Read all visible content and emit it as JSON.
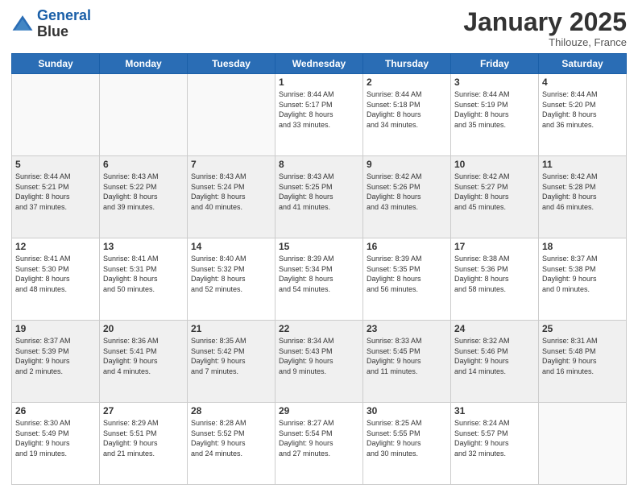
{
  "logo": {
    "line1": "General",
    "line2": "Blue"
  },
  "header": {
    "month": "January 2025",
    "location": "Thilouze, France"
  },
  "weekdays": [
    "Sunday",
    "Monday",
    "Tuesday",
    "Wednesday",
    "Thursday",
    "Friday",
    "Saturday"
  ],
  "weeks": [
    [
      {
        "day": "",
        "info": ""
      },
      {
        "day": "",
        "info": ""
      },
      {
        "day": "",
        "info": ""
      },
      {
        "day": "1",
        "info": "Sunrise: 8:44 AM\nSunset: 5:17 PM\nDaylight: 8 hours\nand 33 minutes."
      },
      {
        "day": "2",
        "info": "Sunrise: 8:44 AM\nSunset: 5:18 PM\nDaylight: 8 hours\nand 34 minutes."
      },
      {
        "day": "3",
        "info": "Sunrise: 8:44 AM\nSunset: 5:19 PM\nDaylight: 8 hours\nand 35 minutes."
      },
      {
        "day": "4",
        "info": "Sunrise: 8:44 AM\nSunset: 5:20 PM\nDaylight: 8 hours\nand 36 minutes."
      }
    ],
    [
      {
        "day": "5",
        "info": "Sunrise: 8:44 AM\nSunset: 5:21 PM\nDaylight: 8 hours\nand 37 minutes."
      },
      {
        "day": "6",
        "info": "Sunrise: 8:43 AM\nSunset: 5:22 PM\nDaylight: 8 hours\nand 39 minutes."
      },
      {
        "day": "7",
        "info": "Sunrise: 8:43 AM\nSunset: 5:24 PM\nDaylight: 8 hours\nand 40 minutes."
      },
      {
        "day": "8",
        "info": "Sunrise: 8:43 AM\nSunset: 5:25 PM\nDaylight: 8 hours\nand 41 minutes."
      },
      {
        "day": "9",
        "info": "Sunrise: 8:42 AM\nSunset: 5:26 PM\nDaylight: 8 hours\nand 43 minutes."
      },
      {
        "day": "10",
        "info": "Sunrise: 8:42 AM\nSunset: 5:27 PM\nDaylight: 8 hours\nand 45 minutes."
      },
      {
        "day": "11",
        "info": "Sunrise: 8:42 AM\nSunset: 5:28 PM\nDaylight: 8 hours\nand 46 minutes."
      }
    ],
    [
      {
        "day": "12",
        "info": "Sunrise: 8:41 AM\nSunset: 5:30 PM\nDaylight: 8 hours\nand 48 minutes."
      },
      {
        "day": "13",
        "info": "Sunrise: 8:41 AM\nSunset: 5:31 PM\nDaylight: 8 hours\nand 50 minutes."
      },
      {
        "day": "14",
        "info": "Sunrise: 8:40 AM\nSunset: 5:32 PM\nDaylight: 8 hours\nand 52 minutes."
      },
      {
        "day": "15",
        "info": "Sunrise: 8:39 AM\nSunset: 5:34 PM\nDaylight: 8 hours\nand 54 minutes."
      },
      {
        "day": "16",
        "info": "Sunrise: 8:39 AM\nSunset: 5:35 PM\nDaylight: 8 hours\nand 56 minutes."
      },
      {
        "day": "17",
        "info": "Sunrise: 8:38 AM\nSunset: 5:36 PM\nDaylight: 8 hours\nand 58 minutes."
      },
      {
        "day": "18",
        "info": "Sunrise: 8:37 AM\nSunset: 5:38 PM\nDaylight: 9 hours\nand 0 minutes."
      }
    ],
    [
      {
        "day": "19",
        "info": "Sunrise: 8:37 AM\nSunset: 5:39 PM\nDaylight: 9 hours\nand 2 minutes."
      },
      {
        "day": "20",
        "info": "Sunrise: 8:36 AM\nSunset: 5:41 PM\nDaylight: 9 hours\nand 4 minutes."
      },
      {
        "day": "21",
        "info": "Sunrise: 8:35 AM\nSunset: 5:42 PM\nDaylight: 9 hours\nand 7 minutes."
      },
      {
        "day": "22",
        "info": "Sunrise: 8:34 AM\nSunset: 5:43 PM\nDaylight: 9 hours\nand 9 minutes."
      },
      {
        "day": "23",
        "info": "Sunrise: 8:33 AM\nSunset: 5:45 PM\nDaylight: 9 hours\nand 11 minutes."
      },
      {
        "day": "24",
        "info": "Sunrise: 8:32 AM\nSunset: 5:46 PM\nDaylight: 9 hours\nand 14 minutes."
      },
      {
        "day": "25",
        "info": "Sunrise: 8:31 AM\nSunset: 5:48 PM\nDaylight: 9 hours\nand 16 minutes."
      }
    ],
    [
      {
        "day": "26",
        "info": "Sunrise: 8:30 AM\nSunset: 5:49 PM\nDaylight: 9 hours\nand 19 minutes."
      },
      {
        "day": "27",
        "info": "Sunrise: 8:29 AM\nSunset: 5:51 PM\nDaylight: 9 hours\nand 21 minutes."
      },
      {
        "day": "28",
        "info": "Sunrise: 8:28 AM\nSunset: 5:52 PM\nDaylight: 9 hours\nand 24 minutes."
      },
      {
        "day": "29",
        "info": "Sunrise: 8:27 AM\nSunset: 5:54 PM\nDaylight: 9 hours\nand 27 minutes."
      },
      {
        "day": "30",
        "info": "Sunrise: 8:25 AM\nSunset: 5:55 PM\nDaylight: 9 hours\nand 30 minutes."
      },
      {
        "day": "31",
        "info": "Sunrise: 8:24 AM\nSunset: 5:57 PM\nDaylight: 9 hours\nand 32 minutes."
      },
      {
        "day": "",
        "info": ""
      }
    ]
  ]
}
